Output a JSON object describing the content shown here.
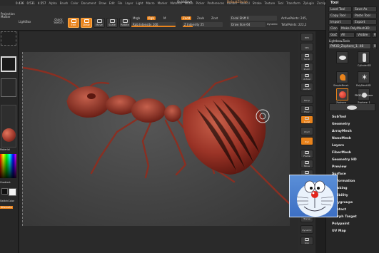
{
  "menu": {
    "left_values": [
      "0.436",
      "0.531",
      "4.557"
    ],
    "items": [
      "Alpha",
      "Brush",
      "Color",
      "Document",
      "Draw",
      "Edit",
      "File",
      "Layer",
      "Light",
      "Macro",
      "Marker",
      "Material",
      "Movie",
      "Picker",
      "Preferences",
      "Render",
      "Stencil",
      "Stroke",
      "Texture",
      "Tool",
      "Transform",
      "Zplugin",
      "Zscript"
    ],
    "quicksave": "QuickSave",
    "script_label": "DefaultZScript"
  },
  "toolbar": {
    "projection": "Projection Master",
    "lightbox": "LightBox",
    "quick_sketch": "Quick Sketch",
    "edit": "Edit",
    "draw": "Draw",
    "move": "Move",
    "scale": "Scale",
    "rotate": "Rotate",
    "mrgb_label": "Mrgb",
    "rgb_label": "Rgb",
    "m_label": "M",
    "rgb_intensity_label": "Rgb Intensity",
    "rgb_intensity_value": "100",
    "zadd": "Zadd",
    "zsub": "Zsub",
    "zcut": "Zcut",
    "z_intensity_label": "Z Intensity",
    "z_intensity_value": "25",
    "focal_shift_label": "Focal Shift",
    "focal_shift_value": "0",
    "draw_size_label": "Draw Size",
    "draw_size_value": "64",
    "dynamic": "Dynamic",
    "active_points_label": "ActivePoints:",
    "active_points_value": "245,",
    "total_points_label": "TotalPoints:",
    "total_points_value": "222,2",
    "rgb_intensity_fraction": 1.0,
    "z_intensity_fraction": 0.25
  },
  "left_panel": {
    "material_label": "Material",
    "gradient_label": "Gradient",
    "switch_label": "SwitchColor",
    "alternate_label": "Alternate"
  },
  "right_shelf": {
    "buttons": [
      "BPR",
      "SPix",
      "Scroll",
      "Zoom",
      "Actual",
      "AAHalf",
      "Persp",
      "Floor",
      "Local",
      "LSym",
      "Xyz",
      "Frame",
      "Move",
      "Scale",
      "Rotate",
      "Line Fill",
      "PolyF",
      "Transp",
      "Dynamic",
      "Solo"
    ]
  },
  "tool_panel": {
    "title": "Tool",
    "buttons": [
      "Load Tool",
      "Save As",
      "Copy Tool",
      "Paste Tool",
      "Import",
      "Export",
      "Clone",
      "Make PolyMesh3D",
      "GoZ",
      "All",
      "Visible",
      "R"
    ],
    "lightbox_tools": "Lightbox▸Tools",
    "current_tool": "PM3D_Zsphere_1. 48",
    "current_r": "R",
    "thumbs": [
      "PM3D_Zsphere",
      "Cylinder3D",
      "SimpleBrush",
      "PolyMesh3D",
      "Zsphere",
      "Zsphere_1",
      "PM3D_Zsphere"
    ],
    "sections": [
      "SubTool",
      "Geometry",
      "ArrayMesh",
      "NanoMesh",
      "Layers",
      "FiberMesh",
      "Geometry HD",
      "Preview",
      "Surface",
      "Deformation",
      "Masking",
      "Visibility",
      "Polygroups",
      "Contact",
      "Morph Target",
      "Polypaint",
      "UV Map"
    ]
  },
  "colors": {
    "accent": "#e9831c",
    "model": "#a0392c",
    "overlay_blue": "#3d6fc3"
  },
  "icons": [
    "edit-icon",
    "draw-icon",
    "move-icon",
    "scale-icon",
    "rotate-icon",
    "brush-cursor-icon"
  ]
}
